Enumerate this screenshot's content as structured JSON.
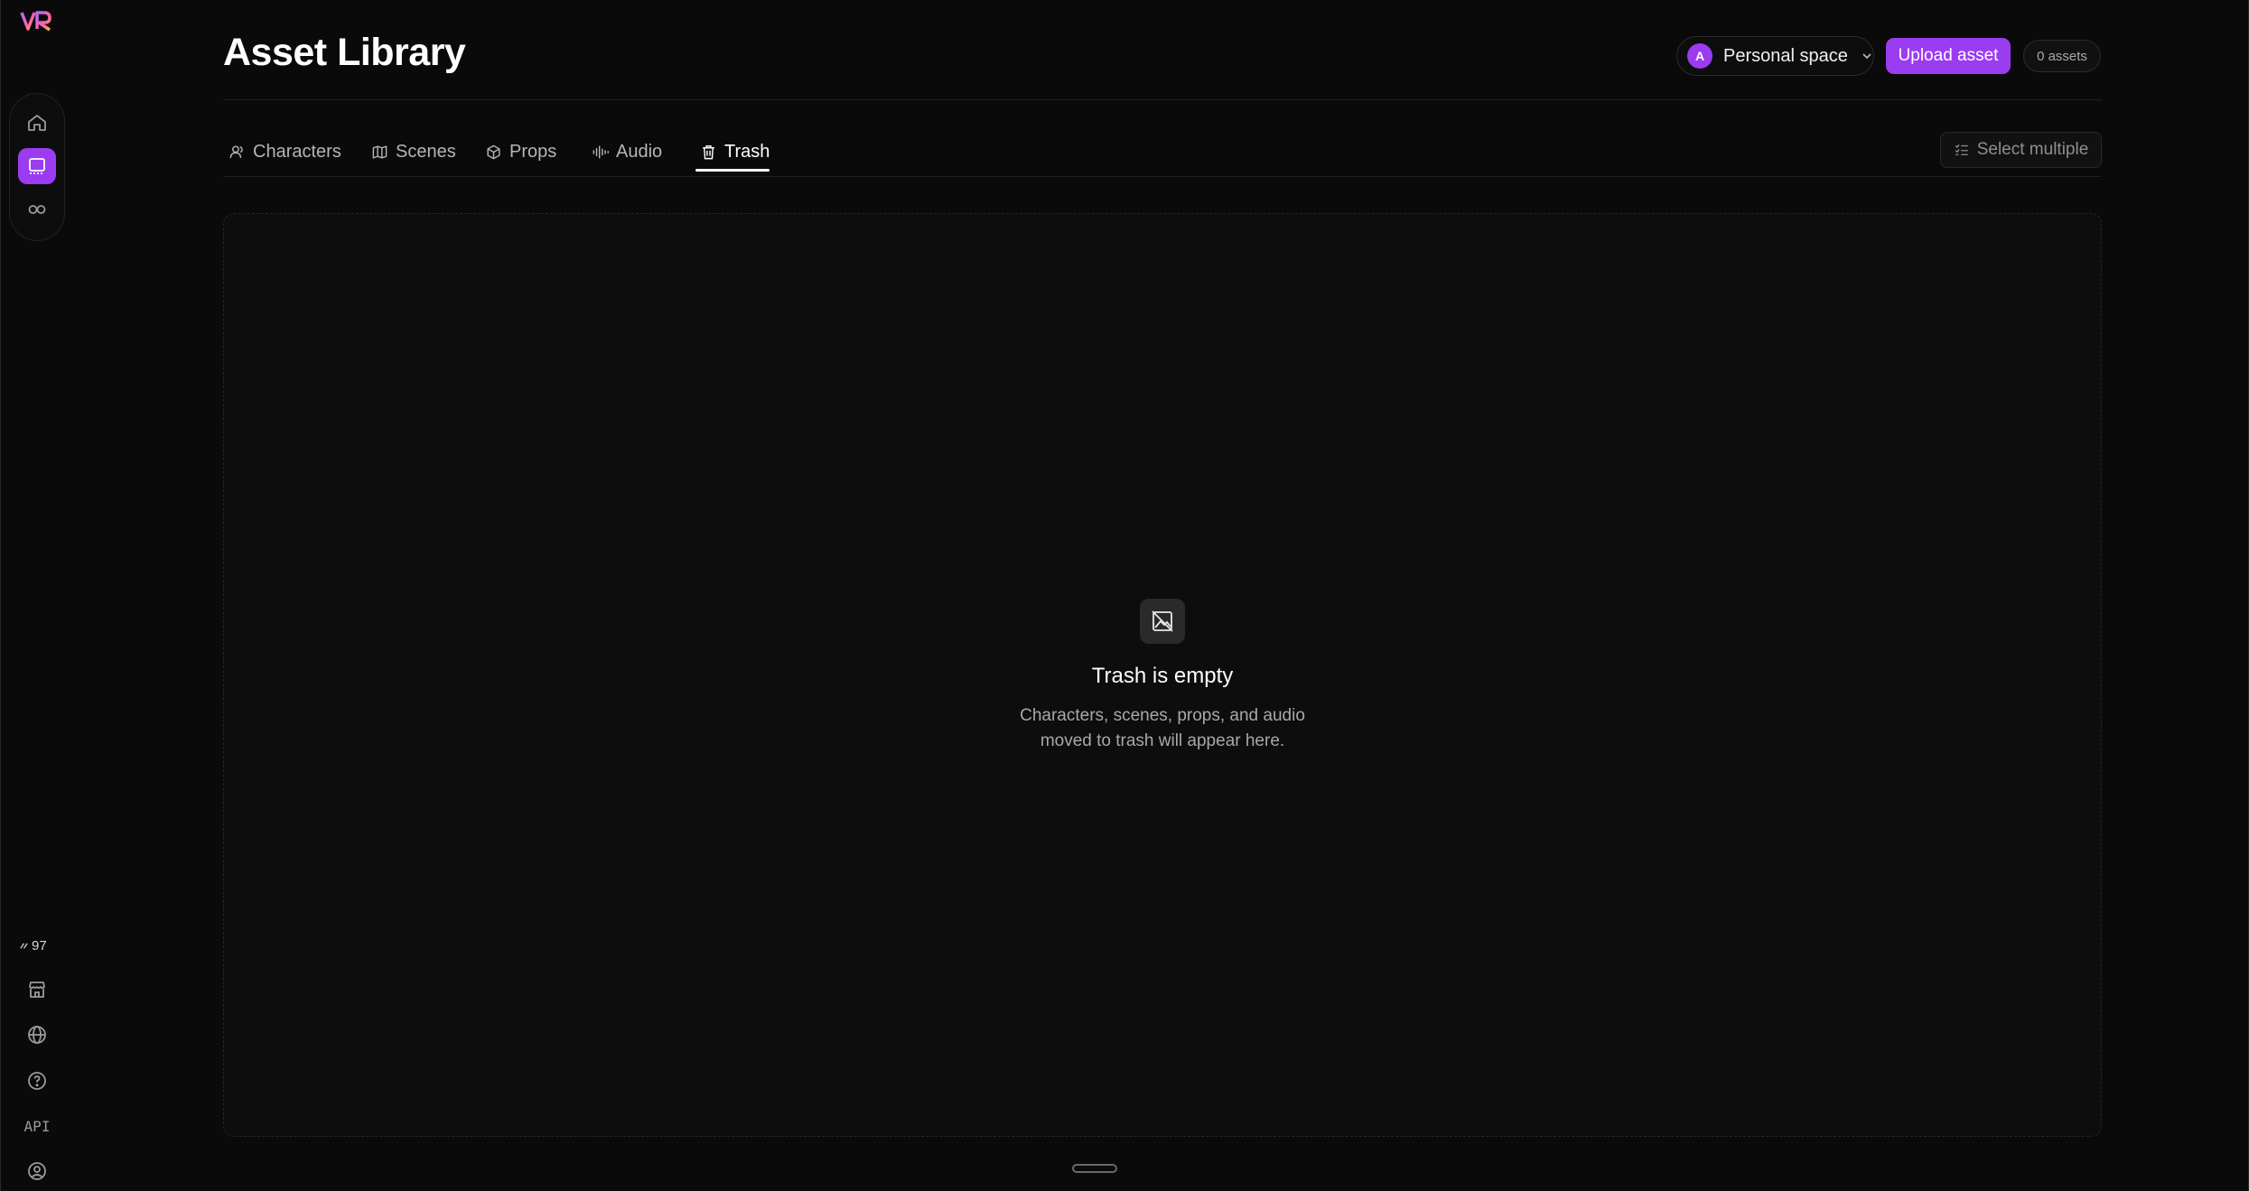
{
  "app": {
    "logo_text": "VR"
  },
  "rail": {
    "top_items": [
      {
        "name": "home",
        "icon": "home-icon"
      },
      {
        "name": "asset-library",
        "icon": "library-icon",
        "active": true
      },
      {
        "name": "infinity",
        "icon": "infinity-icon"
      }
    ],
    "credits": "97",
    "bottom_items": [
      {
        "name": "store",
        "icon": "store-icon"
      },
      {
        "name": "language",
        "icon": "globe-icon"
      },
      {
        "name": "help",
        "icon": "help-icon"
      },
      {
        "name": "api",
        "label": "API"
      },
      {
        "name": "profile",
        "icon": "user-circle-icon"
      }
    ]
  },
  "header": {
    "title": "Asset Library",
    "space": {
      "avatar_letter": "A",
      "label": "Personal space"
    },
    "upload_label": "Upload asset",
    "asset_count": "0 assets"
  },
  "tabs": [
    {
      "label": "Characters",
      "icon": "person-icon"
    },
    {
      "label": "Scenes",
      "icon": "map-icon"
    },
    {
      "label": "Props",
      "icon": "box-icon"
    },
    {
      "label": "Audio",
      "icon": "audio-wave-icon"
    },
    {
      "label": "Trash",
      "icon": "trash-icon",
      "active": true
    }
  ],
  "select_multiple_label": "Select multiple",
  "empty_state": {
    "icon": "image-off-icon",
    "title": "Trash is empty",
    "description_line1": "Characters, scenes, props, and audio",
    "description_line2": "moved to trash will appear here."
  },
  "colors": {
    "accent": "#9b3cf0",
    "background": "#0a0a0a"
  }
}
